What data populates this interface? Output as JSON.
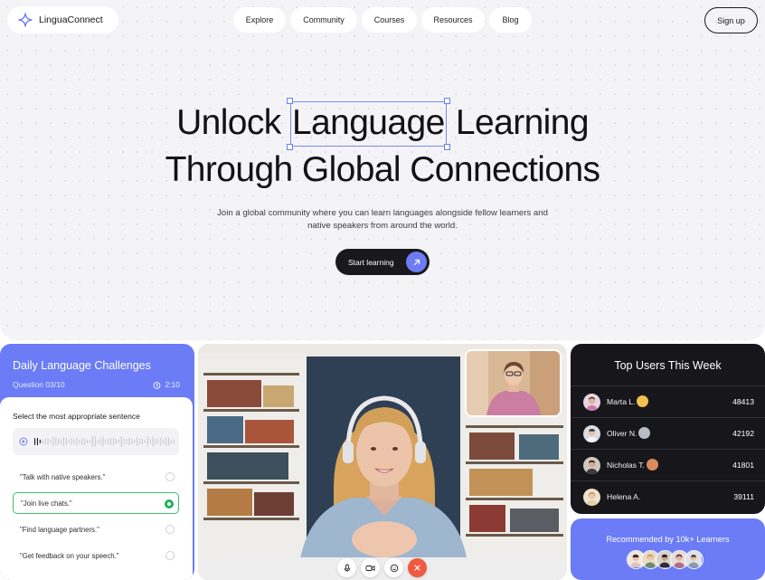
{
  "brand": {
    "name": "LinguaConnect",
    "logo_icon": "sparkle-star-icon",
    "accent": "#6b7cf6"
  },
  "nav": {
    "items": [
      {
        "label": "Explore"
      },
      {
        "label": "Community"
      },
      {
        "label": "Courses"
      },
      {
        "label": "Resources"
      },
      {
        "label": "Blog"
      }
    ],
    "signup_label": "Sign up"
  },
  "hero": {
    "line1_before": "Unlock",
    "line1_selected": "Language",
    "line1_after": "Learning",
    "line2": "Through Global Connections",
    "subtext_line1": "Join a global community where you can learn languages alongside fellow learners and",
    "subtext_line2": "native speakers from around the world.",
    "cta_label": "Start learning",
    "cta_icon": "arrow-up-right-icon"
  },
  "challenge": {
    "title": "Daily Language Challenges",
    "question_counter": "Question 03/10",
    "timer": "2:10",
    "prompt": "Select the most appropriate sentence",
    "options": [
      {
        "text": "\"Talk with native speakers.\"",
        "selected": false
      },
      {
        "text": "\"Join live chats.\"",
        "selected": true
      },
      {
        "text": "\"Find language partners.\"",
        "selected": false
      },
      {
        "text": "\"Get feedback on your speech.\"",
        "selected": false
      }
    ],
    "success_color": "#20b05a"
  },
  "call": {
    "controls": [
      {
        "icon": "microphone-icon"
      },
      {
        "icon": "video-camera-icon"
      },
      {
        "icon": "emoji-icon"
      },
      {
        "icon": "close-icon",
        "color": "#f0593f"
      }
    ]
  },
  "leaderboard": {
    "title": "Top Users This Week",
    "users": [
      {
        "name": "Marta L.",
        "score": "48413",
        "badge_color": "#f2c14e"
      },
      {
        "name": "Oliver N.",
        "score": "42192",
        "badge_color": "#b9bcc4"
      },
      {
        "name": "Nicholas T.",
        "score": "41801",
        "badge_color": "#d98b5a"
      },
      {
        "name": "Helena A.",
        "score": "39111",
        "badge_color": ""
      }
    ]
  },
  "recommended": {
    "text": "Recommended by 10k+ Learners",
    "avatar_count": 5
  }
}
